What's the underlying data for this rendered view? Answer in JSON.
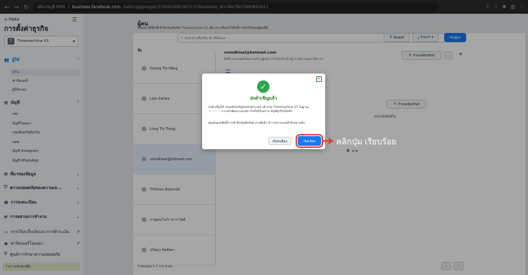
{
  "browser": {
    "tab_title": "เลือกบัญชี BMS",
    "url_domain": "business.facebook.com",
    "url_path": "/settings/people/378201695387572?business_id=3427837840805411"
  },
  "sidebar": {
    "logo": "∞ Meta",
    "title": "การตั้งค่าธุรกิจ",
    "business_avatar": "T",
    "business_name": "Timemachine V1",
    "sections": [
      {
        "label": "ผู้ใช้",
        "items": [
          "ผู้คน",
          "พาร์ทเนอร์",
          "ผู้ใช้ระบบ"
        ]
      },
      {
        "label": "บัญชี",
        "items": [
          "เพจ",
          "บัญชีโฆษณา",
          "กลุ่มสินทรัพย์ธุรกิจ",
          "แอพ",
          "บัญชี Instagram",
          "บัญชี WhatsApp"
        ]
      },
      {
        "label": "ที่มาของข้อมูล"
      },
      {
        "label": "ความปลอดภัยของความเห..."
      },
      {
        "label": "การลงทะเบียน"
      },
      {
        "label": "การผสานการทำงาน"
      },
      {
        "label": "การเรียกเก็บเงินและการชำระเงิน"
      },
      {
        "label": "พาร์ทเนอร์โฆษณา"
      },
      {
        "label": "ศูนย์การรักษาความปลอดภัย"
      }
    ],
    "help": "? ความช่วยเหลือ"
  },
  "main": {
    "title": "ผู้คน",
    "description": "คนเหล่านี้มีสิทธิ์เข้าถึงเซลท์ธุรกิจ Timemachine V1 เพิ่ม ลบ หรือแก้ไขสิทธิ์การเข้าถึงของผู้คนที่นี่",
    "search_placeholder": "ค้นหาด้วยชื่อหรือ ID หรืออีเมล",
    "filter_label": "ฟิลเตอร์",
    "export_label": "Export",
    "add_label": "เชิญผู้คน",
    "list_header": "ชื่อ",
    "people": [
      "Duong Thi Hằng",
      "Lala Zahwa",
      "Lùng Thị Trang",
      "nolodhisel@hotmail.com",
      "Thitinan Boonnak",
      "กาญจนโกเก้า ดาราวัลย์",
      "ปรัชญา ศิลป์ยดา"
    ],
    "pager": "กำลังแสดง 1-7 จาก 8 คน",
    "detail": {
      "email": "nolodhisel@hotmail.com",
      "subtitle": "สิทธิ์การควบคุมโฆษณาธุรกิจ พูดอย่าง สำเร็จแล้วเข้าอยู่ การเงิน (คุณมาจัดการ)",
      "assign_label": "กำหนดสินทรัพย์",
      "more": "…",
      "tab": "เพจ",
      "assign_label2": "กำหนดสินทรัพย์",
      "note": "ยังไม่ได้มีสิทธิ์ได้",
      "dropdown_value": "ดาย"
    }
  },
  "modal": {
    "title": "ส่งคำเชิญแล้ว",
    "body": "ส่งคำเชิญให้ nolodhisel@hotmail.com เข้าร่วม Timemachine V1 ในฐานะ ············· การเข้าพัฒนาและสุขารักษ์ได้รับทราบ บัญชีธุรกิจได้แล้ว",
    "body2": "คุณยังมอบสิทธิ์การเข้าถึงบัญชีทรัพยากรเพิ่มอีก 8 รายการแบบทั่วถึงอย่างเดิม",
    "more_button": "เพิ่มคนอื่นๆ",
    "done_button": "เรียบร้อย"
  },
  "annotation": "คลิกปุ่ม เรียบร้อย",
  "colors": {
    "accent": "#1877f2",
    "success": "#2ea44f",
    "highlight": "#e53935"
  }
}
